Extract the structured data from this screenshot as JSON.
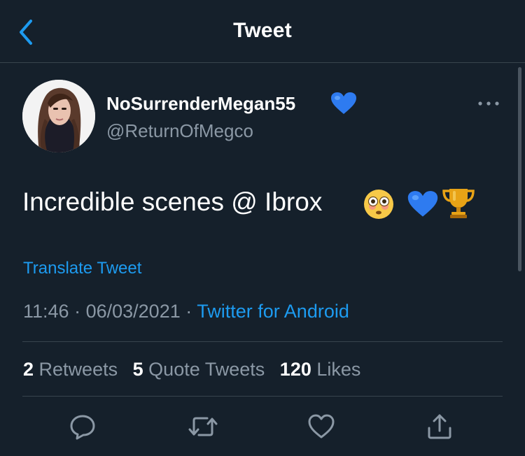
{
  "header": {
    "title": "Tweet",
    "back_icon": "chevron-left-icon"
  },
  "author": {
    "display_name": "NoSurrenderMegan55",
    "handle": "@ReturnOfMegco",
    "name_badge": "blue-heart-emoji"
  },
  "tweet": {
    "text": "Incredible scenes @ Ibrox",
    "emojis": [
      "flushed-face-emoji",
      "blue-heart-emoji",
      "trophy-emoji"
    ],
    "translate_label": "Translate Tweet",
    "time": "11:46",
    "date": "06/03/2021",
    "separator": "·",
    "source": "Twitter for Android"
  },
  "stats": {
    "retweets_count": "2",
    "retweets_label": "Retweets",
    "quotes_count": "5",
    "quotes_label": "Quote Tweets",
    "likes_count": "120",
    "likes_label": "Likes"
  },
  "actions": [
    "reply-icon",
    "retweet-icon",
    "like-icon",
    "share-icon"
  ],
  "colors": {
    "background": "#15202b",
    "accent": "#1d9bf0",
    "secondary_text": "#8b98a5",
    "divider": "#38444d"
  }
}
